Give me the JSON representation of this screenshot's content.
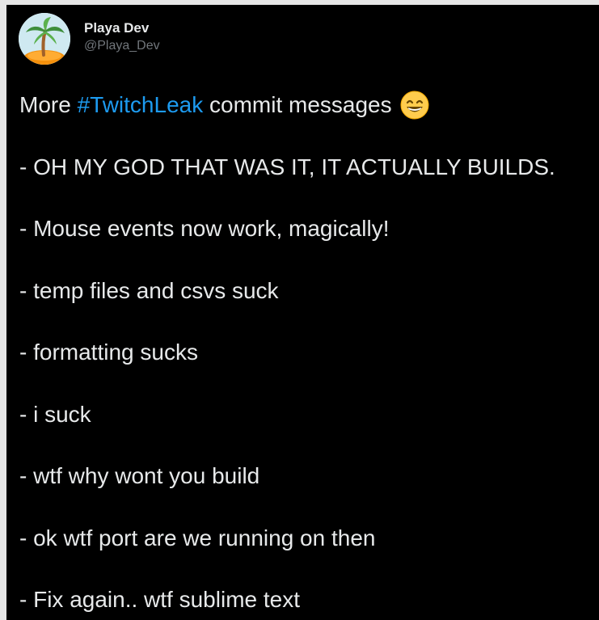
{
  "author": {
    "display_name": "Playa Dev",
    "handle": "@Playa_Dev",
    "avatar_icon": "palm-tree-island-icon"
  },
  "tweet": {
    "intro_prefix": "More",
    "hashtag": "#TwitchLeak",
    "intro_suffix": "commit messages",
    "emoji_icon": "grinning-face-with-smiling-eyes-icon",
    "lines": [
      "- OH MY GOD THAT WAS IT, IT ACTUALLY BUILDS.",
      "- Mouse events now work, magically!",
      "- temp files and csvs suck",
      "- formatting sucks",
      "- i suck",
      "- wtf why wont you build",
      "- ok wtf port are we running on then",
      "- Fix again.. wtf sublime text"
    ]
  },
  "colors": {
    "background": "#000000",
    "text": "#e7e9ea",
    "secondary_text": "#71767b",
    "link": "#1d9bf0",
    "page_edge": "#e6e6e6"
  }
}
